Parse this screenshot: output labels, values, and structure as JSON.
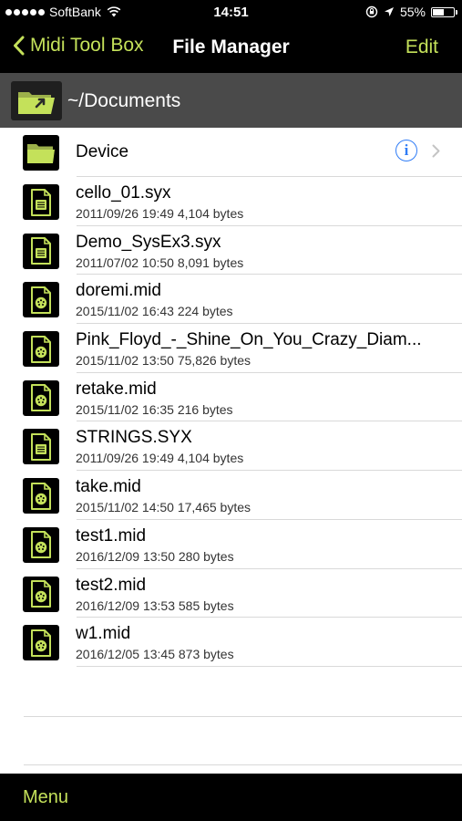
{
  "status_bar": {
    "carrier": "SoftBank",
    "time": "14:51",
    "battery_percent": "55%",
    "battery_level": 0.55
  },
  "nav": {
    "back_label": "Midi Tool Box",
    "title": "File Manager",
    "edit_label": "Edit"
  },
  "path": {
    "current": "~/Documents"
  },
  "device_row": {
    "label": "Device",
    "info_glyph": "i"
  },
  "files": [
    {
      "name": "cello_01.syx",
      "meta": "2011/09/26 19:49 4,104 bytes",
      "kind": "syx"
    },
    {
      "name": "Demo_SysEx3.syx",
      "meta": "2011/07/02 10:50 8,091 bytes",
      "kind": "syx"
    },
    {
      "name": "doremi.mid",
      "meta": "2015/11/02 16:43 224 bytes",
      "kind": "mid"
    },
    {
      "name": "Pink_Floyd_-_Shine_On_You_Crazy_Diam...",
      "meta": "2015/11/02 13:50 75,826 bytes",
      "kind": "mid"
    },
    {
      "name": "retake.mid",
      "meta": "2015/11/02 16:35 216 bytes",
      "kind": "mid"
    },
    {
      "name": "STRINGS.SYX",
      "meta": "2011/09/26 19:49 4,104 bytes",
      "kind": "syx"
    },
    {
      "name": "take.mid",
      "meta": "2015/11/02 14:50 17,465 bytes",
      "kind": "mid"
    },
    {
      "name": "test1.mid",
      "meta": "2016/12/09 13:50 280 bytes",
      "kind": "mid"
    },
    {
      "name": "test2.mid",
      "meta": "2016/12/09 13:53 585 bytes",
      "kind": "mid"
    },
    {
      "name": "w1.mid",
      "meta": "2016/12/05 13:45 873 bytes",
      "kind": "mid"
    }
  ],
  "toolbar": {
    "menu_label": "Menu"
  },
  "colors": {
    "accent": "#c4e15a",
    "info_blue": "#2f7cf6",
    "bar_black": "#000000",
    "path_gray": "#4a4a4a"
  }
}
